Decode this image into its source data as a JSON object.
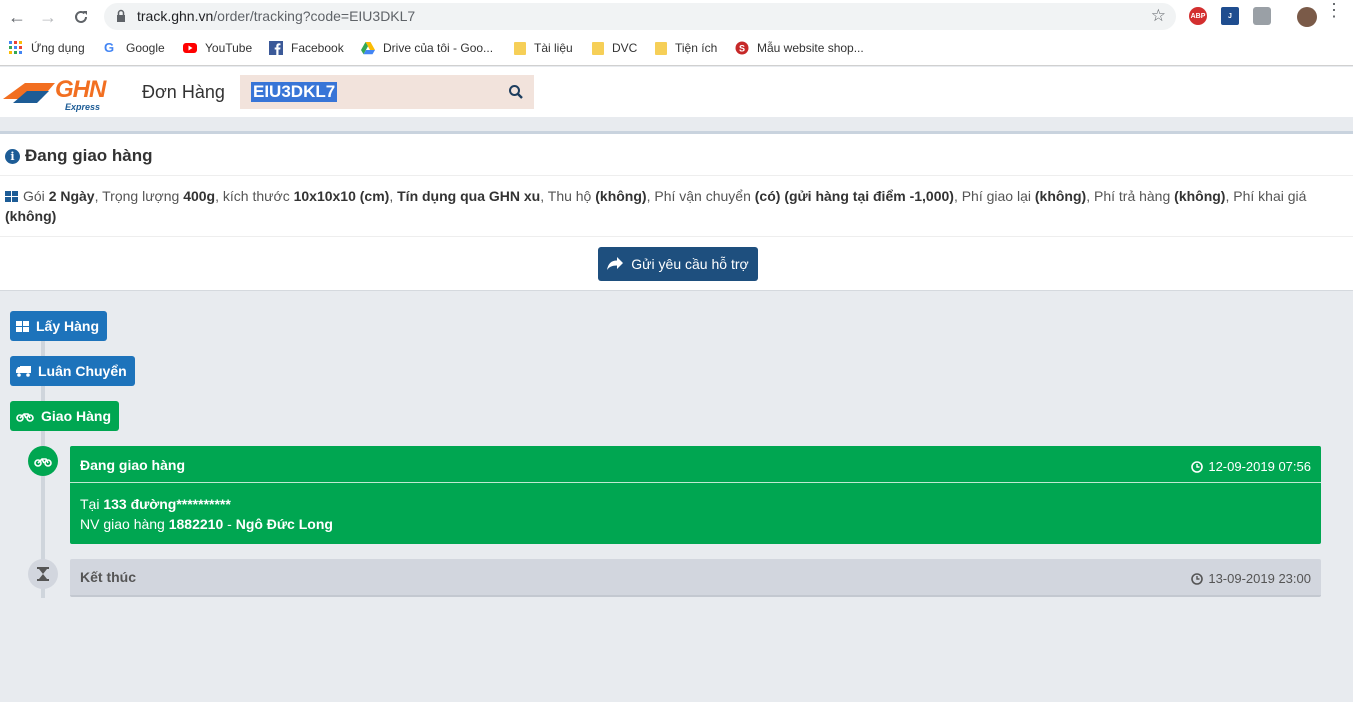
{
  "browser": {
    "url_host": "track.ghn.vn",
    "url_path": "/order/tracking?code=EIU3DKL7",
    "bookmarks": [
      {
        "label": "Ứng dụng",
        "icon": "apps-grid-icon"
      },
      {
        "label": "Google",
        "icon": "google-icon"
      },
      {
        "label": "YouTube",
        "icon": "youtube-icon"
      },
      {
        "label": "Facebook",
        "icon": "facebook-icon"
      },
      {
        "label": "Drive của tôi - Goo...",
        "icon": "drive-icon"
      },
      {
        "label": "Tài liệu",
        "icon": "folder-icon"
      },
      {
        "label": "DVC",
        "icon": "folder-icon"
      },
      {
        "label": "Tiện ích",
        "icon": "folder-icon"
      },
      {
        "label": "Mẫu website shop...",
        "icon": "site-icon"
      }
    ],
    "extensions": [
      "ABP"
    ]
  },
  "header": {
    "logo_text": "GHN",
    "logo_sub": "Express",
    "title": "Đơn Hàng",
    "search_value": "EIU3DKL7"
  },
  "status": {
    "heading": "Đang giao hàng",
    "details": {
      "t1": "Gói ",
      "package": "2 Ngày",
      "t2": ", Trọng lượng ",
      "weight": "400g",
      "t3": ", kích thước ",
      "size": "10x10x10 (cm)",
      "t4": ", ",
      "credit": "Tín dụng qua GHN xu",
      "t5": ", Thu hộ ",
      "cod": "(không)",
      "t6": ", Phí vận chuyển ",
      "shipping": "(có) (gửi hàng tại điểm -1,000)",
      "t7": ", Phí giao lại ",
      "redeliver": "(không)",
      "t8": ", Phí trả hàng ",
      "return_fee": "(không)",
      "t9": ", Phí khai giá ",
      "declared": "(không)"
    },
    "support_button": "Gửi yêu cầu hỗ trợ"
  },
  "timeline": {
    "stages": [
      "Lấy Hàng",
      "Luân Chuyển",
      "Giao Hàng"
    ],
    "events": [
      {
        "title": "Đang giao hàng",
        "time": "12-09-2019 07:56",
        "loc_prefix": "Tại ",
        "location": "133 đường**********",
        "staff_prefix": "NV giao hàng ",
        "staff_id": "1882210",
        "staff_sep": " - ",
        "staff_name": "Ngô Đức Long"
      },
      {
        "title": "Kết thúc",
        "time": "13-09-2019 23:00"
      }
    ]
  },
  "colors": {
    "brand_orange": "#f26f21",
    "brand_blue": "#1d5c96",
    "stage_blue": "#1d73bb",
    "success_green": "#00a651",
    "button_navy": "#1e4f7e"
  }
}
